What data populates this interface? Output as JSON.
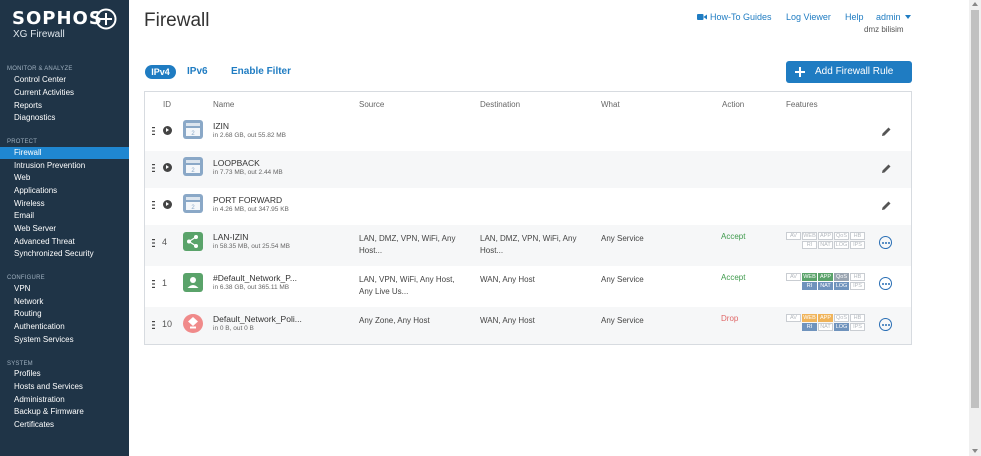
{
  "brand": {
    "name": "SOPHOS",
    "product": "XG Firewall"
  },
  "sidebar": {
    "sections": [
      {
        "label": "MONITOR & ANALYZE",
        "items": [
          "Control Center",
          "Current Activities",
          "Reports",
          "Diagnostics"
        ]
      },
      {
        "label": "PROTECT",
        "items": [
          "Firewall",
          "Intrusion Prevention",
          "Web",
          "Applications",
          "Wireless",
          "Email",
          "Web Server",
          "Advanced Threat",
          "Synchronized Security"
        ]
      },
      {
        "label": "CONFIGURE",
        "items": [
          "VPN",
          "Network",
          "Routing",
          "Authentication",
          "System Services"
        ]
      },
      {
        "label": "SYSTEM",
        "items": [
          "Profiles",
          "Hosts and Services",
          "Administration",
          "Backup & Firmware",
          "Certificates"
        ]
      }
    ],
    "active": "Firewall"
  },
  "header": {
    "title": "Firewall",
    "howto": "How-To Guides",
    "log_viewer": "Log Viewer",
    "help": "Help",
    "user": "admin",
    "org": "dmz bilisim"
  },
  "tabs": {
    "ipv4": "IPv4",
    "ipv6": "IPv6",
    "filter": "Enable Filter"
  },
  "add_button": "Add Firewall Rule",
  "table": {
    "headers": {
      "id": "ID",
      "name": "Name",
      "source": "Source",
      "destination": "Destination",
      "what": "What",
      "action": "Action",
      "features": "Features"
    },
    "rows": [
      {
        "type": "group",
        "id": "",
        "name": "IZIN",
        "traffic": "in 2.68 GB, out 55.82 MB",
        "source": "",
        "destination": "",
        "what": "",
        "action": ""
      },
      {
        "type": "group",
        "id": "",
        "name": "LOOPBACK",
        "traffic": "in 7.73 MB, out 2.44 MB",
        "source": "",
        "destination": "",
        "what": "",
        "action": ""
      },
      {
        "type": "group",
        "id": "",
        "name": "PORT FORWARD",
        "traffic": "in 4.26 MB, out 347.95 KB",
        "source": "",
        "destination": "",
        "what": "",
        "action": ""
      },
      {
        "type": "rule",
        "id": "4",
        "name": "LAN-IZIN",
        "traffic": "in 58.35 MB, out 25.54 MB",
        "source": "LAN, DMZ, VPN, WiFi, Any Host...",
        "destination": "LAN, DMZ, VPN, WiFi, Any Host...",
        "what": "Any Service",
        "action": "Accept"
      },
      {
        "type": "rule",
        "id": "1",
        "name": "#Default_Network_P...",
        "traffic": "in 6.38 GB, out 365.11 MB",
        "source": "LAN, VPN, WiFi, Any Host, Any Live Us...",
        "destination": "WAN, Any Host",
        "what": "Any Service",
        "action": "Accept"
      },
      {
        "type": "rule",
        "id": "10",
        "name": "Default_Network_Poli...",
        "traffic": "in 0 B, out 0 B",
        "source": "Any Zone, Any Host",
        "destination": "WAN, Any Host",
        "what": "Any Service",
        "action": "Drop"
      }
    ],
    "feature_labels": [
      "AV",
      "WEB",
      "APP",
      "QoS",
      "HB",
      "RI",
      "NAT",
      "LOG",
      "IPS"
    ]
  },
  "colors": {
    "sidebar": "#1f3447",
    "accent": "#1f7cc2",
    "accept": "#3e9a4c",
    "drop": "#e06868"
  }
}
